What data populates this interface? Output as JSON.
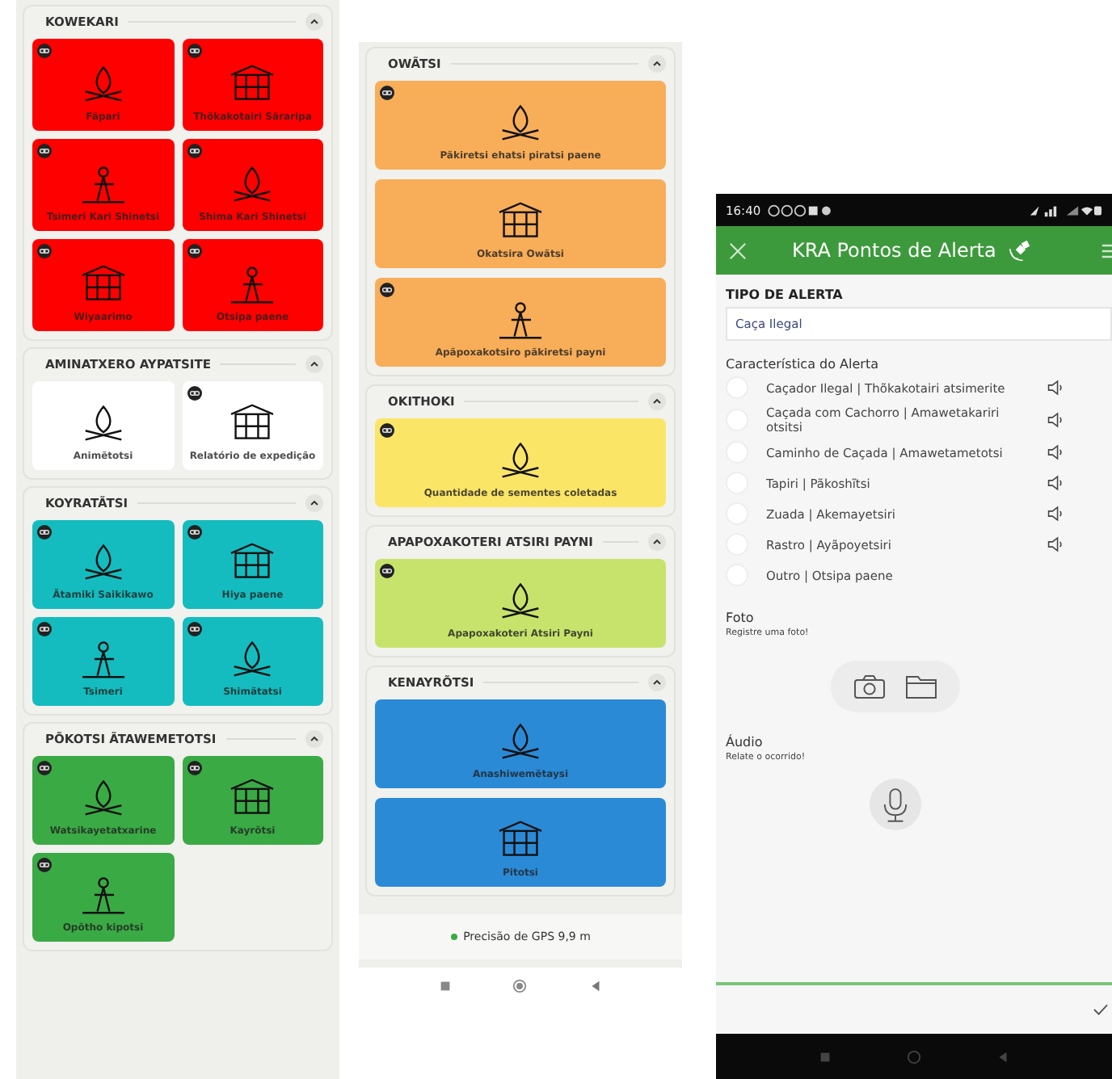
{
  "left_panel": {
    "sections": [
      {
        "title": "KOWEKARI",
        "expanded": true,
        "color": "#fe0000",
        "tiles": [
          {
            "label": "Fãpari",
            "linked": true
          },
          {
            "label": "Thõkakotairi Sãraripa",
            "linked": true
          },
          {
            "label": "Tsimeri Kari Shinetsi",
            "linked": true
          },
          {
            "label": "Shima Kari Shinetsi",
            "linked": true
          },
          {
            "label": "Wiyaarimo",
            "linked": true
          },
          {
            "label": "Otsipa paene",
            "linked": true
          }
        ]
      },
      {
        "title": "AMINATXERO AYPATSITE",
        "expanded": true,
        "color": "#ffffff",
        "tiles": [
          {
            "label": "Animẽtotsi",
            "linked": false
          },
          {
            "label": "Relatório de expedição",
            "linked": true
          }
        ]
      },
      {
        "title": "KOYRATÃTSI",
        "expanded": true,
        "color": "#14bcbf",
        "tiles": [
          {
            "label": "Ãtamiki Saikikawo",
            "linked": true
          },
          {
            "label": "Hiya paene",
            "linked": true
          },
          {
            "label": "Tsimeri",
            "linked": true
          },
          {
            "label": "Shimãtatsi",
            "linked": true
          }
        ]
      },
      {
        "title": "PÕKOTSI ÃTAWEMETOTSI",
        "expanded": true,
        "color": "#3aaa45",
        "tiles": [
          {
            "label": "Watsikayetatxarine",
            "linked": true
          },
          {
            "label": "Kayrõtsi",
            "linked": true
          },
          {
            "label": "Opõtho kipotsi",
            "linked": true
          }
        ]
      }
    ]
  },
  "middle_panel": {
    "sections": [
      {
        "title": "OWÃTSI",
        "expanded": true,
        "color": "#f8ad58",
        "tiles": [
          {
            "label": "Pãkiretsi ehatsi piratsi paene",
            "linked": true
          },
          {
            "label": "Okatsira Owãtsi",
            "linked": false
          },
          {
            "label": "Apãpoxakotsiro pãkiretsi payni",
            "linked": true
          }
        ]
      },
      {
        "title": "OKITHOKI",
        "expanded": true,
        "color": "#fbe567",
        "tiles": [
          {
            "label": "Quantidade de sementes coletadas",
            "linked": true
          }
        ]
      },
      {
        "title": "APAPOXAKOTERI ATSIRI PAYNI",
        "expanded": true,
        "color": "#c7e36c",
        "tiles": [
          {
            "label": "Apapoxakoteri Atsiri Payni",
            "linked": true
          }
        ]
      },
      {
        "title": "KENAYRÕTSI",
        "expanded": true,
        "color": "#2a8ad6",
        "tiles": [
          {
            "label": "Anashiwemẽtaysi",
            "linked": false
          },
          {
            "label": "Pitotsi",
            "linked": false
          }
        ]
      }
    ],
    "gps_status": "Precisão de GPS 9,9 m"
  },
  "right_panel": {
    "status_bar": {
      "time": "16:40"
    },
    "header": {
      "title": "KRA Pontos de Alerta"
    },
    "alert_type": {
      "label": "TIPO DE ALERTA",
      "value": "Caça Ilegal"
    },
    "characteristic": {
      "label": "Característica do Alerta",
      "options": [
        {
          "label": "Caçador Ilegal | Thõkakotairi atsimerite",
          "selected": false,
          "audio": true
        },
        {
          "label": "Caçada com Cachorro | Amawetakariri otsitsi",
          "selected": false,
          "audio": true
        },
        {
          "label": "Caminho de Caçada | Amawetametotsi",
          "selected": false,
          "audio": true
        },
        {
          "label": "Tapiri | Pãkoshĩtsi",
          "selected": false,
          "audio": true
        },
        {
          "label": "Zuada | Akemayetsiri",
          "selected": false,
          "audio": true
        },
        {
          "label": "Rastro | Ayãpoyetsiri",
          "selected": false,
          "audio": true
        },
        {
          "label": "Outro | Otsipa paene",
          "selected": false,
          "audio": false
        }
      ]
    },
    "photo": {
      "label": "Foto",
      "hint": "Registre uma foto!"
    },
    "audio": {
      "label": "Áudio",
      "hint": "Relate o ocorrido!"
    }
  }
}
